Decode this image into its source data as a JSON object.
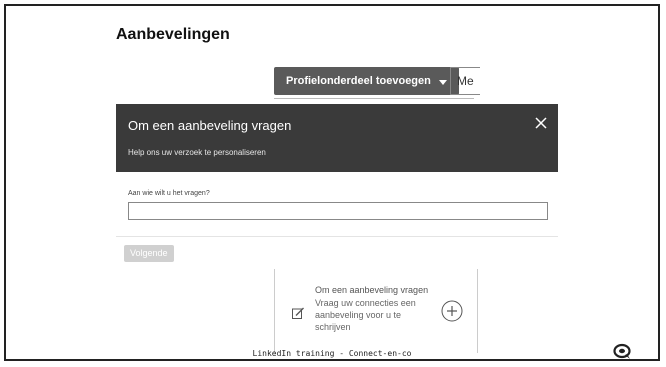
{
  "slide": {
    "title": "Aanbevelingen",
    "footer": "LinkedIn training - Connect-en-co"
  },
  "profile": {
    "add_section_label": "Profielonderdeel toevoegen",
    "more_label": "Me"
  },
  "modal": {
    "title": "Om een aanbeveling vragen",
    "subtitle": "Help ons uw verzoek te personaliseren",
    "field_label": "Aan wie wilt u het vragen?",
    "field_value": "",
    "next_label": "Volgende"
  },
  "card": {
    "title": "Om een aanbeveling vragen",
    "description": "Vraag uw connecties een aanbeveling voor u te schrijven"
  },
  "icons": {
    "close": "close-icon",
    "pencil": "pencil-icon",
    "plus": "plus-icon",
    "logo": "chat-bubble-logo-icon",
    "caret": "caret-down-icon"
  },
  "colors": {
    "modal_header": "#3a3a3a",
    "profile_button": "#5a5a5a",
    "next_button_disabled": "#d0d0d0"
  }
}
